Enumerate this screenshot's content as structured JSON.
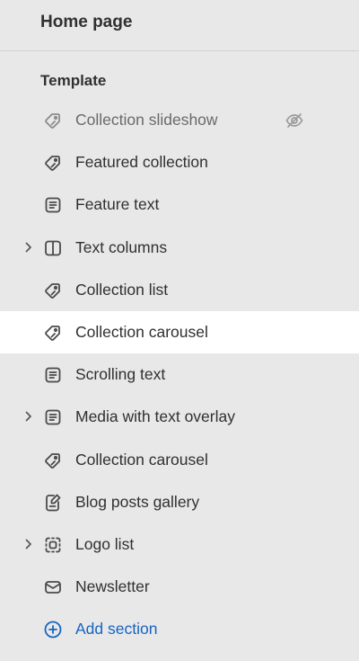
{
  "header": {
    "title": "Home page"
  },
  "template": {
    "label": "Template",
    "items": [
      {
        "label": "Collection slideshow",
        "icon": "tag-icon",
        "hidden": true,
        "expandable": false,
        "selected": false
      },
      {
        "label": "Featured collection",
        "icon": "tag-icon",
        "hidden": false,
        "expandable": false,
        "selected": false
      },
      {
        "label": "Feature text",
        "icon": "text-block-icon",
        "hidden": false,
        "expandable": false,
        "selected": false
      },
      {
        "label": "Text columns",
        "icon": "columns-icon",
        "hidden": false,
        "expandable": true,
        "selected": false
      },
      {
        "label": "Collection list",
        "icon": "tag-icon",
        "hidden": false,
        "expandable": false,
        "selected": false
      },
      {
        "label": "Collection carousel",
        "icon": "tag-icon",
        "hidden": false,
        "expandable": false,
        "selected": true
      },
      {
        "label": "Scrolling text",
        "icon": "text-block-icon",
        "hidden": false,
        "expandable": false,
        "selected": false
      },
      {
        "label": "Media with text overlay",
        "icon": "text-block-icon",
        "hidden": false,
        "expandable": true,
        "selected": false
      },
      {
        "label": "Collection carousel",
        "icon": "tag-icon",
        "hidden": false,
        "expandable": false,
        "selected": false
      },
      {
        "label": "Blog posts gallery",
        "icon": "blog-post-icon",
        "hidden": false,
        "expandable": false,
        "selected": false
      },
      {
        "label": "Logo list",
        "icon": "logo-frame-icon",
        "hidden": false,
        "expandable": true,
        "selected": false
      },
      {
        "label": "Newsletter",
        "icon": "envelope-icon",
        "hidden": false,
        "expandable": false,
        "selected": false
      }
    ],
    "add_section_label": "Add section"
  },
  "colors": {
    "background": "#e8e8e8",
    "selected": "#ffffff",
    "link": "#1565c0",
    "text": "#303030"
  }
}
